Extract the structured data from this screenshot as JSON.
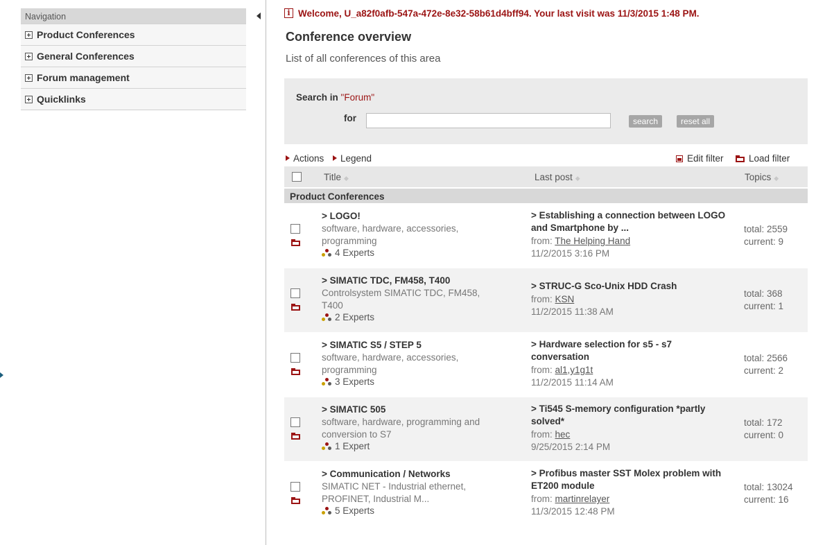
{
  "sidebar": {
    "header": "Navigation",
    "items": [
      {
        "label": "Product Conferences"
      },
      {
        "label": "General Conferences"
      },
      {
        "label": "Forum management"
      },
      {
        "label": "Quicklinks"
      }
    ]
  },
  "welcome": "Welcome, U_a82f0afb-547a-472e-8e32-58b61d4bff94. Your last visit was 11/3/2015 1:48 PM.",
  "info_glyph": "i",
  "page": {
    "title": "Conference overview",
    "subtitle": "List of all conferences of this area"
  },
  "search": {
    "label_prefix": "Search in ",
    "scope": "\"Forum\"",
    "for_label": "for",
    "input_value": "",
    "search_button": "search",
    "reset_button": "reset all"
  },
  "actions": {
    "actions_label": "Actions",
    "legend_label": "Legend",
    "edit_filter": "Edit filter",
    "load_filter": "Load filter"
  },
  "table": {
    "columns": {
      "title": "Title",
      "last_post": "Last post",
      "topics": "Topics"
    },
    "sort_glyph": "◆",
    "group": "Product Conferences",
    "rows": [
      {
        "title": "> LOGO!",
        "desc": "software, hardware, accessories, programming",
        "experts": "4 Experts",
        "post": "> Establishing a connection between LOGO and Smartphone by ...",
        "from_label": "from: ",
        "author": "The Helping Hand",
        "date": "11/2/2015 3:16 PM",
        "total": "total: 2559",
        "current": "current: 9"
      },
      {
        "title": "> SIMATIC TDC, FM458, T400",
        "desc": "Controlsystem SIMATIC TDC, FM458, T400",
        "experts": "2 Experts",
        "post": "> STRUC-G Sco-Unix HDD Crash",
        "from_label": "from: ",
        "author": "KSN",
        "date": "11/2/2015 11:38 AM",
        "total": "total: 368",
        "current": "current: 1"
      },
      {
        "title": "> SIMATIC S5 / STEP 5",
        "desc": "software, hardware, accessories, programming",
        "experts": "3 Experts",
        "post": "> Hardware selection for s5 - s7 conversation",
        "from_label": "from: ",
        "author": "al1,y1g1t",
        "date": "11/2/2015 11:14 AM",
        "total": "total: 2566",
        "current": "current: 2"
      },
      {
        "title": "> SIMATIC 505",
        "desc": "software, hardware, programming and conversion to S7",
        "experts": "1 Expert",
        "post": "> Ti545 S-memory configuration *partly solved*",
        "from_label": "from: ",
        "author": "hec",
        "date": "9/25/2015 2:14 PM",
        "total": "total: 172",
        "current": "current: 0"
      },
      {
        "title": "> Communication / Networks",
        "desc": "SIMATIC NET - Industrial ethernet, PROFINET, Industrial M...",
        "experts": "5 Experts",
        "post": "> Profibus master SST Molex problem with ET200 module",
        "from_label": "from: ",
        "author": "martinrelayer",
        "date": "11/3/2015 12:48 PM",
        "total": "total: 13024",
        "current": "current: 16"
      }
    ]
  },
  "colors": {
    "accent": "#9b1313",
    "panel": "#ebebeb",
    "header": "#d8d8d8"
  }
}
